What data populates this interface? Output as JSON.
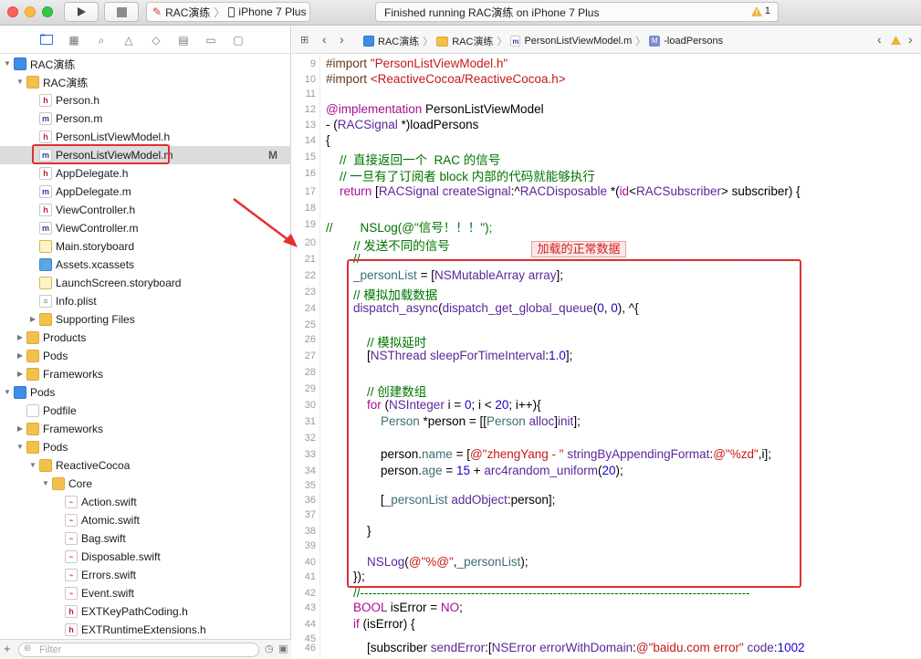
{
  "toolbar": {
    "scheme_project": "RAC演练",
    "scheme_device": "iPhone 7 Plus",
    "status_text": "Finished running RAC演练 on iPhone 7 Plus",
    "warning_count": "1"
  },
  "navigator": {
    "rows": [
      {
        "label": "RAC演练",
        "icon": "proj",
        "indent": 1,
        "disc": "open"
      },
      {
        "label": "RAC演练",
        "icon": "folder",
        "indent": 2,
        "disc": "open"
      },
      {
        "label": "Person.h",
        "icon": "h",
        "indent": 3,
        "disc": ""
      },
      {
        "label": "Person.m",
        "icon": "m",
        "indent": 3,
        "disc": ""
      },
      {
        "label": "PersonListViewModel.h",
        "icon": "h",
        "indent": 3,
        "disc": ""
      },
      {
        "label": "PersonListViewModel.m",
        "icon": "m",
        "indent": 3,
        "disc": "",
        "selected": true,
        "flag": "M"
      },
      {
        "label": "AppDelegate.h",
        "icon": "h",
        "indent": 3,
        "disc": ""
      },
      {
        "label": "AppDelegate.m",
        "icon": "m",
        "indent": 3,
        "disc": ""
      },
      {
        "label": "ViewController.h",
        "icon": "h",
        "indent": 3,
        "disc": ""
      },
      {
        "label": "ViewController.m",
        "icon": "m",
        "indent": 3,
        "disc": ""
      },
      {
        "label": "Main.storyboard",
        "icon": "sb",
        "indent": 3,
        "disc": ""
      },
      {
        "label": "Assets.xcassets",
        "icon": "xcas",
        "indent": 3,
        "disc": ""
      },
      {
        "label": "LaunchScreen.storyboard",
        "icon": "sb",
        "indent": 3,
        "disc": ""
      },
      {
        "label": "Info.plist",
        "icon": "plist",
        "indent": 3,
        "disc": ""
      },
      {
        "label": "Supporting Files",
        "icon": "folder",
        "indent": 3,
        "disc": "closed"
      },
      {
        "label": "Products",
        "icon": "folder",
        "indent": 2,
        "disc": "closed"
      },
      {
        "label": "Pods",
        "icon": "folder",
        "indent": 2,
        "disc": "closed"
      },
      {
        "label": "Frameworks",
        "icon": "folder",
        "indent": 2,
        "disc": "closed"
      },
      {
        "label": "Pods",
        "icon": "proj",
        "indent": 1,
        "disc": "open"
      },
      {
        "label": "Podfile",
        "icon": "generic",
        "indent": 2,
        "disc": ""
      },
      {
        "label": "Frameworks",
        "icon": "folder",
        "indent": 2,
        "disc": "closed"
      },
      {
        "label": "Pods",
        "icon": "folder",
        "indent": 2,
        "disc": "open"
      },
      {
        "label": "ReactiveCocoa",
        "icon": "folder",
        "indent": 3,
        "disc": "open"
      },
      {
        "label": "Core",
        "icon": "folder",
        "indent": 4,
        "disc": "open"
      },
      {
        "label": "Action.swift",
        "icon": "swift",
        "indent": 5,
        "disc": ""
      },
      {
        "label": "Atomic.swift",
        "icon": "swift",
        "indent": 5,
        "disc": ""
      },
      {
        "label": "Bag.swift",
        "icon": "swift",
        "indent": 5,
        "disc": ""
      },
      {
        "label": "Disposable.swift",
        "icon": "swift",
        "indent": 5,
        "disc": ""
      },
      {
        "label": "Errors.swift",
        "icon": "swift",
        "indent": 5,
        "disc": ""
      },
      {
        "label": "Event.swift",
        "icon": "swift",
        "indent": 5,
        "disc": ""
      },
      {
        "label": "EXTKeyPathCoding.h",
        "icon": "h",
        "indent": 5,
        "disc": ""
      },
      {
        "label": "EXTRuntimeExtensions.h",
        "icon": "h",
        "indent": 5,
        "disc": ""
      }
    ],
    "filter_placeholder": "Filter"
  },
  "jumpbar": {
    "crumbs": [
      "RAC演练",
      "RAC演练",
      "PersonListViewModel.m",
      "-loadPersons"
    ],
    "method_badge": "M"
  },
  "editor": {
    "annotation": "加载的正常数据",
    "lines": [
      {
        "n": "9",
        "html": "<span class='pp'>#import </span><span class='str'>\"PersonListViewModel.h\"</span>"
      },
      {
        "n": "10",
        "html": "<span class='pp'>#import </span><span class='str'>&lt;ReactiveCocoa/ReactiveCocoa.h&gt;</span>"
      },
      {
        "n": "11",
        "html": ""
      },
      {
        "n": "12",
        "html": "<span class='kw'>@implementation</span> PersonListViewModel"
      },
      {
        "n": "13",
        "html": "- (<span class='cls'>RACSignal</span> *)loadPersons"
      },
      {
        "n": "14",
        "html": "{"
      },
      {
        "n": "15",
        "html": "    <span class='cm'>//  直接返回一个  RAC 的信号</span>"
      },
      {
        "n": "16",
        "html": "    <span class='cm'>// 一旦有了订阅者 block 内部的代码就能够执行</span>"
      },
      {
        "n": "17",
        "html": "    <span class='kw'>return</span> [<span class='cls'>RACSignal</span> <span class='cls'>createSignal</span>:^<span class='cls'>RACDisposable</span> *(<span class='kw'>id</span>&lt;<span class='cls'>RACSubscriber</span>&gt; subscriber) {"
      },
      {
        "n": "18",
        "html": ""
      },
      {
        "n": "19",
        "html": "<span class='cm'>//        NSLog(@\"信号！！！\");</span>"
      },
      {
        "n": "20",
        "html": "        <span class='cm'>// 发送不同的信号</span>"
      },
      {
        "n": "21",
        "html": "        <span class='cm'>//-----------------------------------------------------------------------------------------------</span>"
      },
      {
        "n": "22",
        "html": "        <span class='ivar'>_personList</span> = [<span class='cls'>NSMutableArray</span> <span class='cls'>array</span>];"
      },
      {
        "n": "23",
        "html": "        <span class='cm'>// 模拟加载数据</span>"
      },
      {
        "n": "24",
        "html": "        <span class='cls'>dispatch_async</span>(<span class='cls'>dispatch_get_global_queue</span>(<span class='num'>0</span>, <span class='num'>0</span>), ^{"
      },
      {
        "n": "25",
        "html": ""
      },
      {
        "n": "26",
        "html": "            <span class='cm'>// 模拟延时</span>"
      },
      {
        "n": "27",
        "html": "            [<span class='cls'>NSThread</span> <span class='cls'>sleepForTimeInterval</span>:<span class='num'>1.0</span>];"
      },
      {
        "n": "28",
        "html": ""
      },
      {
        "n": "29",
        "html": "            <span class='cm'>// 创建数组</span>"
      },
      {
        "n": "30",
        "html": "            <span class='kw'>for</span> (<span class='cls'>NSInteger</span> i = <span class='num'>0</span>; i &lt; <span class='num'>20</span>; i++){"
      },
      {
        "n": "31",
        "html": "                <span class='ivar'>Person</span> *person = [[<span class='ivar'>Person</span> <span class='cls'>alloc</span>]<span class='cls'>init</span>];"
      },
      {
        "n": "32",
        "html": ""
      },
      {
        "n": "33",
        "html": "                person.<span class='ivar'>name</span> = [<span class='str'>@\"zhengYang - \"</span> <span class='cls'>stringByAppendingFormat</span>:<span class='str'>@\"%zd\"</span>,i];"
      },
      {
        "n": "34",
        "html": "                person.<span class='ivar'>age</span> = <span class='num'>15</span> + <span class='cls'>arc4random_uniform</span>(<span class='num'>20</span>);"
      },
      {
        "n": "35",
        "html": ""
      },
      {
        "n": "36",
        "html": "                [<span class='ivar'>_personList</span> <span class='cls'>addObject</span>:person];"
      },
      {
        "n": "37",
        "html": ""
      },
      {
        "n": "38",
        "html": "            }"
      },
      {
        "n": "39",
        "html": ""
      },
      {
        "n": "40",
        "html": "            <span class='cls'>NSLog</span>(<span class='str'>@\"%@\"</span>,<span class='ivar'>_personList</span>);"
      },
      {
        "n": "41",
        "html": "        });"
      },
      {
        "n": "42",
        "html": "        <span class='cm'>//-----------------------------------------------------------------------------------------------</span>"
      },
      {
        "n": "43",
        "html": "        <span class='kw'>BOOL</span> isError = <span class='kw'>NO</span>;"
      },
      {
        "n": "44",
        "html": "        <span class='kw'>if</span> (isError) {"
      },
      {
        "n": "45",
        "html": ""
      },
      {
        "n": "46",
        "html": "            [subscriber <span class='cls'>sendError</span>:[<span class='cls'>NSError</span> <span class='cls'>errorWithDomain</span>:<span class='str'>@\"baidu.com error\"</span> <span class='cls'>code</span>:<span class='num'>1002</span>"
      }
    ]
  }
}
